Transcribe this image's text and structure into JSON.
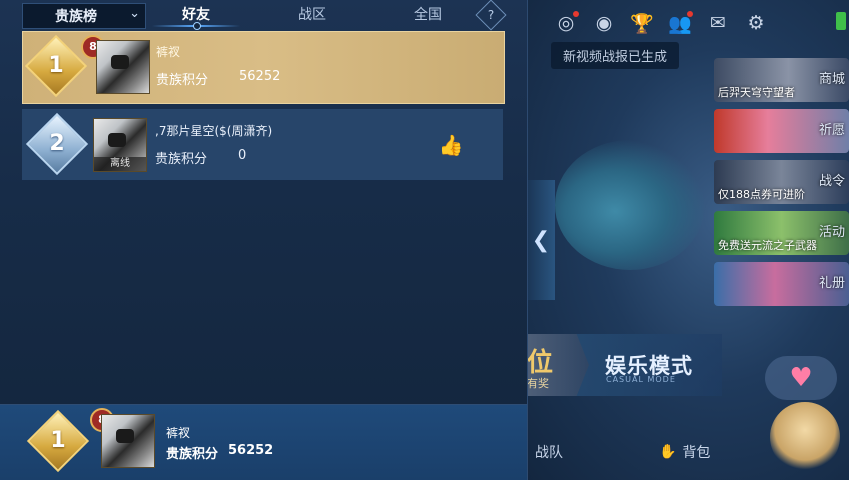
{
  "leaderboard": {
    "selector_label": "贵族榜",
    "tabs": [
      {
        "label": "好友",
        "active": true
      },
      {
        "label": "战区",
        "active": false
      },
      {
        "label": "全国",
        "active": false
      }
    ],
    "help_label": "?",
    "entries": [
      {
        "rank": "1",
        "level": "8",
        "name": "裤衩",
        "score_label": "贵族积分",
        "score": "56252",
        "status": ""
      },
      {
        "rank": "2",
        "level": "",
        "name": ",7那片星空($(周潇齐)",
        "score_label": "贵族积分",
        "score": "0",
        "status": "离线"
      }
    ],
    "my_entry": {
      "rank": "1",
      "level": "8",
      "name": "裤衩",
      "score_label": "贵族积分",
      "score": "56252"
    }
  },
  "lobby": {
    "toast": "新视频战报已生成",
    "side_tiles": [
      {
        "caption": "后羿天穹守望者",
        "label": "商城"
      },
      {
        "caption": "",
        "label": "祈愿"
      },
      {
        "caption": "仅188点券可进阶",
        "label": "战令"
      },
      {
        "caption": "免费送元流之子武器",
        "label": "活动"
      },
      {
        "caption": "",
        "label": "礼册"
      }
    ],
    "mode_left_big": "位",
    "mode_left_small": "有奖",
    "mode_title": "娱乐模式",
    "mode_subtitle": "CASUAL MODE",
    "bottom_nav": {
      "team": "战队",
      "bag": "背包"
    }
  },
  "colors": {
    "gold_row": "#d9bd86",
    "blue_row": "#27456a",
    "panel_bg": "#172c48",
    "tab_accent": "#5aaaff"
  },
  "icons": {
    "top_bar": [
      "target-icon",
      "eye-icon",
      "trophy-icon",
      "friends-icon",
      "mail-icon",
      "gear-icon"
    ]
  }
}
